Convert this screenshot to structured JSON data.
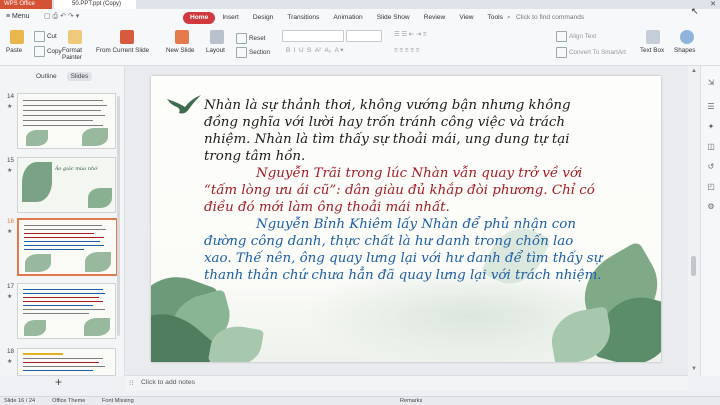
{
  "window": {
    "doc_tab": "WPS Office",
    "file_tab": "50.PPT.ppt (Copy)",
    "close": "✕"
  },
  "menu": {
    "label": "Menu",
    "tabs": [
      "Home",
      "Insert",
      "Design",
      "Transitions",
      "Animation",
      "Slide Show",
      "Review",
      "View",
      "Tools"
    ],
    "active_tab": "Home",
    "search_placeholder": "Click to find commands"
  },
  "ribbon": {
    "paste": "Paste",
    "cut": "Cut",
    "copy": "Copy",
    "format_painter": "Format Painter",
    "from_current_slide": "From Current Slide",
    "new_slide": "New Slide",
    "layout": "Layout",
    "reset": "Reset",
    "section": "Section",
    "align_text": "Align Text",
    "convert_to_smartart": "Convert To SmartArt",
    "text_box": "Text Box",
    "shapes": "Shapes"
  },
  "left_panel": {
    "tabs": [
      "Outline",
      "Slides"
    ],
    "active_tab": "Slides",
    "slides": [
      {
        "num": "14",
        "selected": false
      },
      {
        "num": "15",
        "selected": false,
        "title": "Ảo giác mùa nhớ"
      },
      {
        "num": "16",
        "selected": true
      },
      {
        "num": "17",
        "selected": false
      },
      {
        "num": "18",
        "selected": false
      }
    ],
    "add_label": "+"
  },
  "slide": {
    "para1": "Nhàn là sự thảnh thơi, không vướng bận nhưng không đồng nghĩa với lười hay trốn tránh công việc và trách nhiệm. Nhàn là tìm thấy sự thoải mái, ung dung tự tại trong tâm hồn.",
    "para2": "Nguyễn Trãi trong lúc Nhàn vẫn quay trở về với “tấm lòng ưu ái cũ”: dân giàu đủ khắp đòi phương. Chỉ có điều đó mới làm ông thoải mái nhất.",
    "para3": "Nguyễn Bỉnh Khiêm lấy Nhàn để phủ nhận con đường công danh, thực chất là hư danh trong chốn lao xao. Thế nên, ông quay lưng lại với hư danh để tìm thấy sự thanh thản chứ chưa hẳn đã quay lưng lại với trách nhiệm.",
    "colors": {
      "para1": "#1c1c1c",
      "para2": "#a51c24",
      "para3": "#1c5fa6"
    }
  },
  "notes": {
    "placeholder": "Click to add notes"
  },
  "status": {
    "slide_info": "Slide 16 / 24",
    "theme": "Office Theme",
    "font_missing": "Font Missing",
    "remarks": "Remarks"
  }
}
